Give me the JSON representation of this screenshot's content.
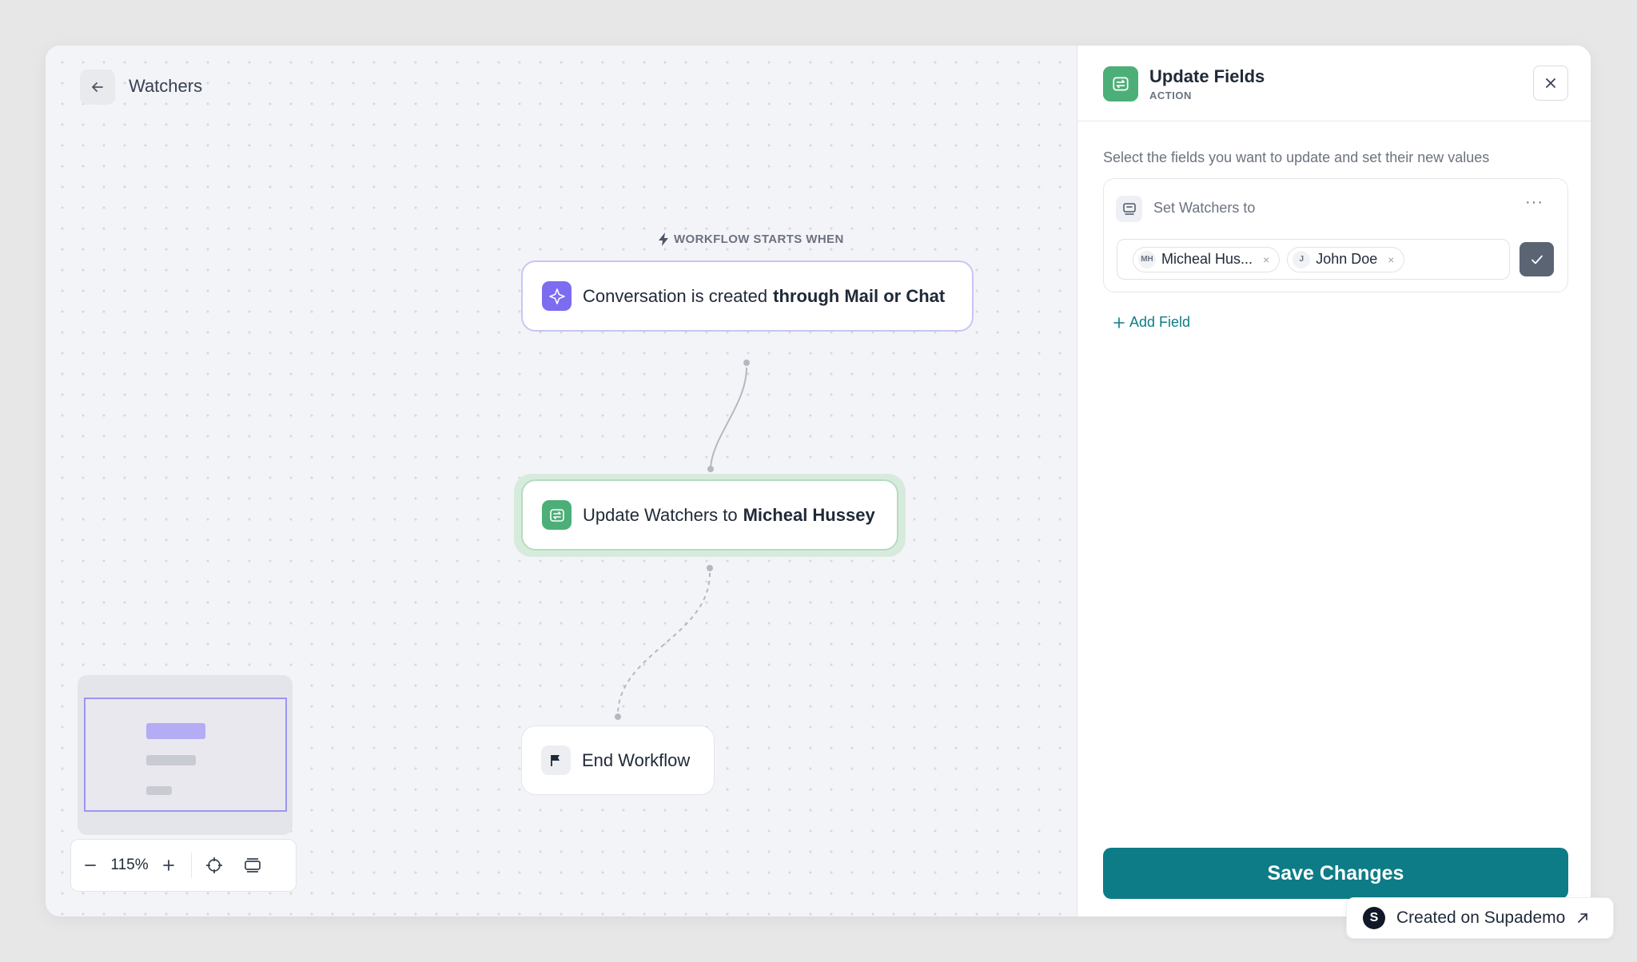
{
  "header": {
    "back_icon": "arrow-left-icon",
    "breadcrumb": "Watchers"
  },
  "workflow": {
    "start_label": "WORKFLOW STARTS WHEN",
    "trigger": {
      "text": "Conversation is created",
      "bold": "through Mail or Chat",
      "icon": "sparkle-icon",
      "color": "#7c6cf0"
    },
    "action": {
      "text": "Update Watchers to",
      "bold": "Micheal Hussey",
      "icon": "swap-icon",
      "color": "#4caf78"
    },
    "end": {
      "text": "End Workflow",
      "icon": "flag-icon"
    }
  },
  "zoom": {
    "level": "115%"
  },
  "panel": {
    "title": "Update Fields",
    "subtitle": "ACTION",
    "description": "Select the fields you want to update and set their new values",
    "field": {
      "title": "Set Watchers to",
      "more": "···",
      "chips": [
        {
          "initials": "MH",
          "name": "Micheal Hus..."
        },
        {
          "initials": "J",
          "name": "John Doe"
        }
      ]
    },
    "add_field": "Add Field",
    "save": "Save Changes",
    "accent": "#0e7c86"
  },
  "badge": {
    "logo": "S",
    "text": "Created on Supademo"
  }
}
